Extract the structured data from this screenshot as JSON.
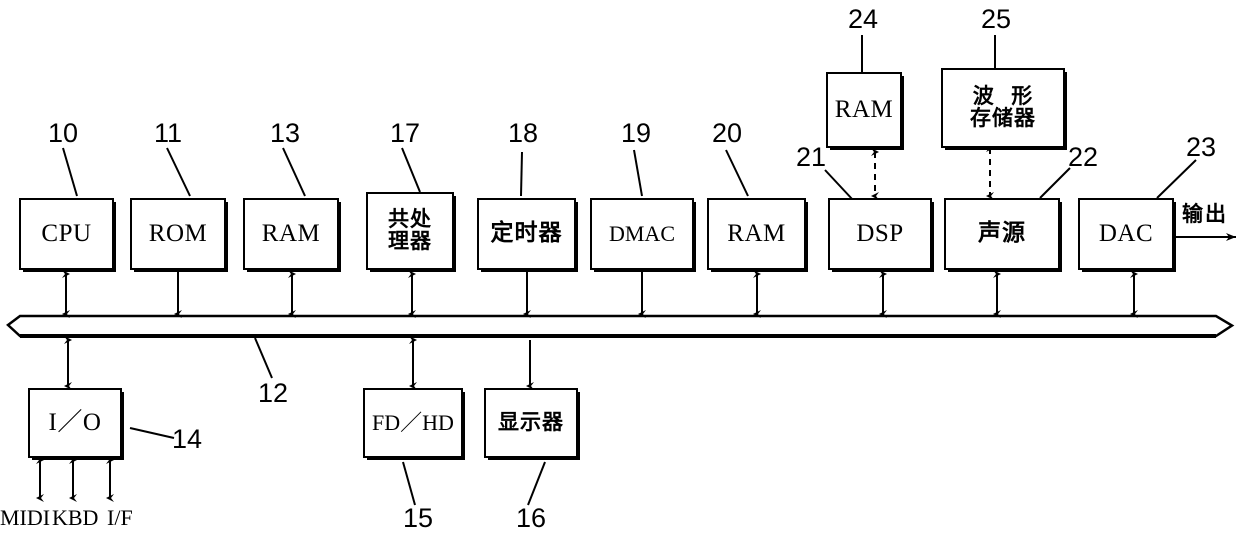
{
  "figure": {
    "type": "patent-block-diagram",
    "background_color": "#ffffff",
    "line_color": "#000000"
  },
  "bus": {
    "label": "12",
    "name": "system-bus"
  },
  "main_row": [
    {
      "id": "cpu",
      "lines": [
        "CPU"
      ],
      "ref": "10",
      "script": "latin",
      "arrow": "double"
    },
    {
      "id": "rom",
      "lines": [
        "ROM"
      ],
      "ref": "11",
      "script": "latin",
      "arrow": "down"
    },
    {
      "id": "ram13",
      "lines": [
        "RAM"
      ],
      "ref": "13",
      "script": "latin",
      "arrow": "double"
    },
    {
      "id": "coproc",
      "lines": [
        "共处",
        "理器"
      ],
      "ref": "17",
      "script": "cjk",
      "arrow": "double"
    },
    {
      "id": "timer",
      "lines": [
        "定时器"
      ],
      "ref": "18",
      "script": "cjk",
      "arrow": "down"
    },
    {
      "id": "dmac",
      "lines": [
        "DMAC"
      ],
      "ref": "19",
      "script": "latin",
      "arrow": "down"
    },
    {
      "id": "ram20",
      "lines": [
        "RAM"
      ],
      "ref": "20",
      "script": "latin",
      "arrow": "double"
    },
    {
      "id": "dsp",
      "lines": [
        "DSP"
      ],
      "ref": "21",
      "script": "latin",
      "arrow": "double"
    },
    {
      "id": "tonegen",
      "lines": [
        "声源"
      ],
      "ref": "22",
      "script": "cjk",
      "arrow": "double"
    },
    {
      "id": "dac",
      "lines": [
        "DAC"
      ],
      "ref": "23",
      "script": "latin",
      "arrow": "double"
    }
  ],
  "top_row": [
    {
      "id": "ram24",
      "lines": [
        "RAM"
      ],
      "ref": "24",
      "script": "latin",
      "connects_to": "dsp",
      "arrow": "dashed-double"
    },
    {
      "id": "wavemem",
      "lines": [
        "波  形",
        "存储器"
      ],
      "ref": "25",
      "script": "cjk",
      "connects_to": "tonegen",
      "arrow": "dashed-double"
    }
  ],
  "bottom_row": [
    {
      "id": "io",
      "lines": [
        "I／O"
      ],
      "ref": "14",
      "script": "latin",
      "arrow": "double"
    },
    {
      "id": "fdhd",
      "lines": [
        "FD／HD"
      ],
      "ref": "15",
      "script": "latin",
      "arrow": "double"
    },
    {
      "id": "display",
      "lines": [
        "显示器"
      ],
      "ref": "16",
      "script": "cjk",
      "arrow": "down"
    }
  ],
  "io_ports": [
    {
      "label": "MIDI"
    },
    {
      "label": "KBD"
    },
    {
      "label": "I/F"
    }
  ],
  "output": {
    "label": "输出"
  }
}
